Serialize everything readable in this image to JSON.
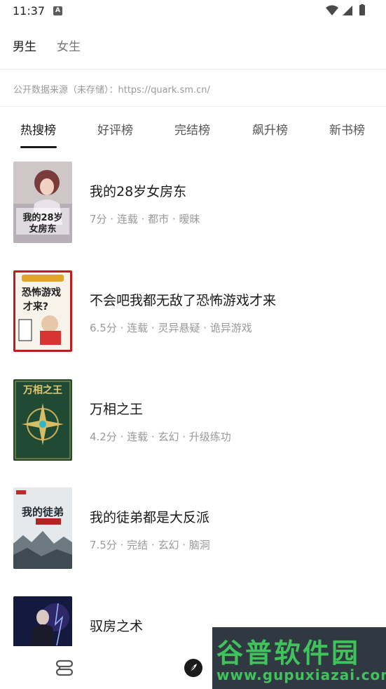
{
  "status_bar": {
    "time": "11:37",
    "notification_badge": "A"
  },
  "gender_tabs": [
    {
      "label": "男生",
      "active": true
    },
    {
      "label": "女生",
      "active": false
    }
  ],
  "source_notice": "公开数据来源（未存储）：https://quark.sm.cn/",
  "rank_tabs": [
    {
      "label": "热搜榜",
      "active": true
    },
    {
      "label": "好评榜",
      "active": false
    },
    {
      "label": "完结榜",
      "active": false
    },
    {
      "label": "飙升榜",
      "active": false
    },
    {
      "label": "新书榜",
      "active": false
    }
  ],
  "books": [
    {
      "title": "我的28岁女房东",
      "meta": "7分 · 连载 · 都市 · 暧昧",
      "cover_text": "我的28岁女房东"
    },
    {
      "title": "不会吧我都无敌了恐怖游戏才来",
      "meta": "6.5分 · 连载 · 灵异悬疑 · 诡异游戏",
      "cover_text": "恐怖游戏才来?"
    },
    {
      "title": "万相之王",
      "meta": "4.2分 · 连载 · 玄幻 · 升级练功",
      "cover_text": "万相之王"
    },
    {
      "title": "我的徒弟都是大反派",
      "meta": "7.5分 · 完结 · 玄幻 · 脑洞",
      "cover_text": "我的徒弟"
    },
    {
      "title": "驭房之术",
      "meta": "",
      "cover_text": ""
    }
  ],
  "bottom_nav": [
    {
      "icon": "bookshelf-icon"
    },
    {
      "icon": "compass-icon"
    }
  ],
  "watermark": {
    "title": "谷普软件园",
    "url": "www.gupuxiazai.com"
  },
  "colors": {
    "accent": "#1a1a1a",
    "muted": "#9a9a9a",
    "watermark_green": "#3fc35a"
  }
}
